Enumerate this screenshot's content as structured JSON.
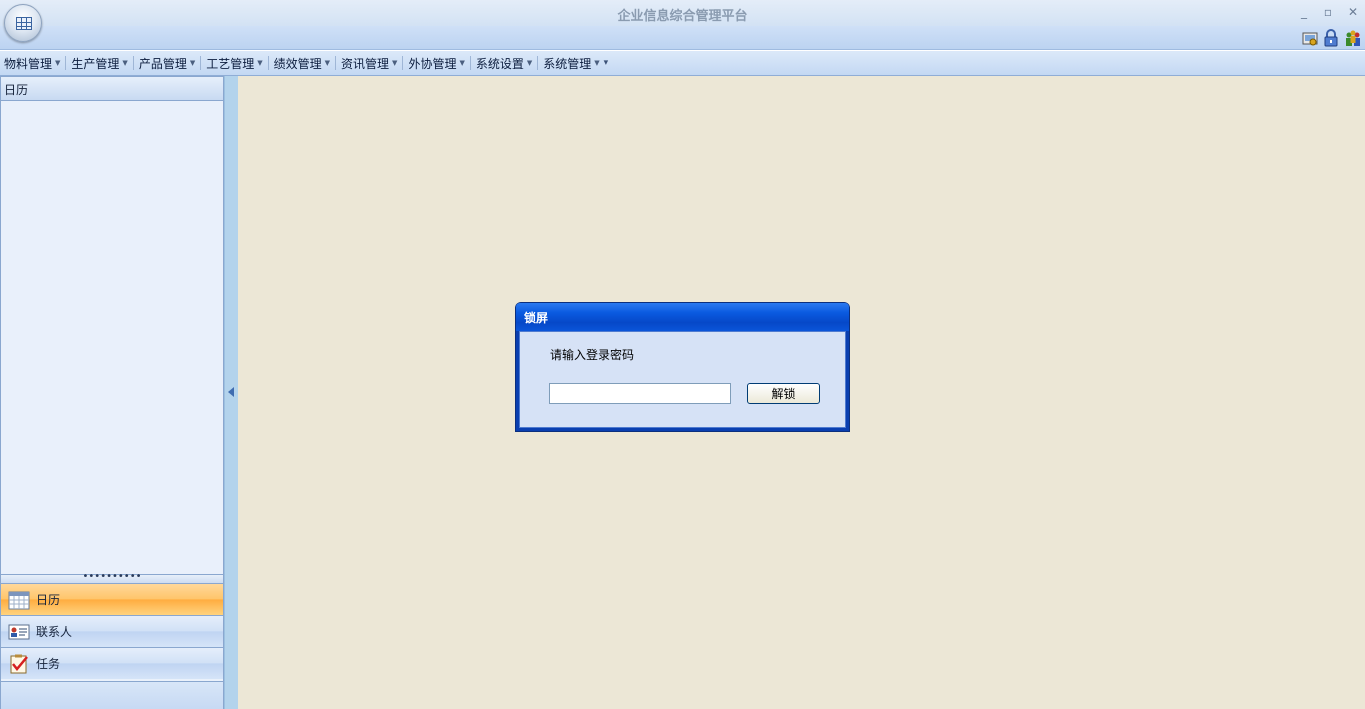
{
  "window": {
    "title": "企业信息综合管理平台",
    "minimize": "_",
    "restore": "▫",
    "close": "✕"
  },
  "quickbar": {
    "icons": [
      "settings-icon",
      "lock-icon",
      "users-icon"
    ]
  },
  "menu": {
    "items": [
      {
        "label": "物料管理"
      },
      {
        "label": "生产管理"
      },
      {
        "label": "产品管理"
      },
      {
        "label": "工艺管理"
      },
      {
        "label": "绩效管理"
      },
      {
        "label": "资讯管理"
      },
      {
        "label": "外协管理"
      },
      {
        "label": "系统设置"
      },
      {
        "label": "系统管理"
      }
    ],
    "caret": "▼",
    "overflow": "▾"
  },
  "sidebar": {
    "header": "日历",
    "grip": "••••••••••",
    "nav": [
      {
        "label": "日历",
        "icon": "calendar-icon",
        "active": true
      },
      {
        "label": "联系人",
        "icon": "contact-card-icon",
        "active": false
      },
      {
        "label": "任务",
        "icon": "task-checklist-icon",
        "active": false
      }
    ]
  },
  "dialog": {
    "title": "锁屏",
    "prompt": "请输入登录密码",
    "password_value": "",
    "unlock_label": "解锁"
  },
  "colors": {
    "dialog_frame": "#0a3fb0",
    "active_nav": "#ffc56a",
    "workspace": "#ece7d6"
  }
}
